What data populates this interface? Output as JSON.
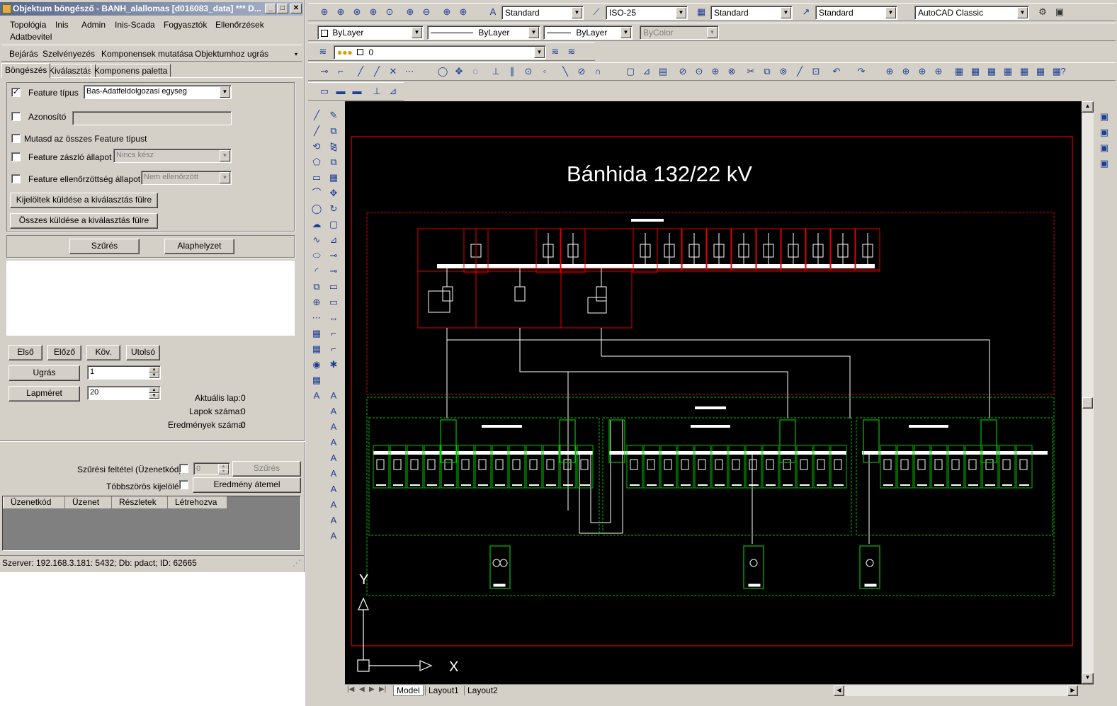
{
  "window": {
    "title": "Objektum böngésző - BANH_alallomas [d016083_data] *** D..."
  },
  "menu": [
    "Topológia",
    "Inis",
    "Admin",
    "Inis-Scada",
    "Fogyasztók",
    "Ellenőrzések",
    "Adatbevitel"
  ],
  "toolbar2": [
    "Bejárás",
    "Szelvényezés",
    "Komponensek mutatása",
    "Objektumhoz ugrás"
  ],
  "tabs": [
    "Böngészés",
    "Kiválasztás",
    "Komponens paletta"
  ],
  "filter": {
    "feature_type_label": "Feature típus",
    "feature_type_value": "Bas-Adatfeldolgozasi egyseg",
    "feature_type_checked": "✓",
    "id_label": "Azonosító",
    "show_all_label": "Mutasd az összes Feature típust",
    "flag_label": "Feature zászló állapot",
    "flag_value": "Nincs kész",
    "checked_label": "Feature ellenőrzöttség állapot",
    "checked_value": "Nem ellenőrzött",
    "send_selected": "Kijelöltek küldése a kiválasztás fülre",
    "send_all": "Összes küldése a kiválasztás fülre",
    "filter_btn": "Szűrés",
    "reset_btn": "Alaphelyzet"
  },
  "paging": {
    "first": "Első",
    "prev": "Előző",
    "next": "Köv.",
    "last": "Utolsó",
    "jump_btn": "Ugrás",
    "jump_value": "1",
    "pagesize_btn": "Lapméret",
    "pagesize_value": "20",
    "current_label": "Aktuális lap:",
    "current_value": "0",
    "pages_label": "Lapok száma:",
    "pages_value": "0",
    "results_label": "Eredmények száma:",
    "results_value": "0"
  },
  "messages": {
    "filter_label": "Szűrési feltétel (Üzenetkód):",
    "filter_value": "0",
    "filter_btn": "Szűrés",
    "multi_label": "Többszörös kijelölés",
    "move_btn": "Eredmény átemel",
    "columns": [
      "Üzenetkód",
      "Üzenet",
      "Részletek",
      "Létrehozva"
    ]
  },
  "status": "Szerver: 192.168.3.181: 5432; Db: pdact; ID: 62665",
  "cad": {
    "text_style": "Standard",
    "dim_style": "ISO-25",
    "table_style": "Standard",
    "multileader_style": "Standard",
    "workspace": "AutoCAD Classic",
    "layer_color": "ByLayer",
    "linetype": "ByLayer",
    "lineweight": "ByLayer",
    "plot_style": "ByColor",
    "layer": "0",
    "drawing_title": "Bánhida 132/22 kV",
    "ucs_x": "X",
    "ucs_y": "Y",
    "layout_tabs": [
      "Model",
      "Layout1",
      "Layout2"
    ]
  }
}
